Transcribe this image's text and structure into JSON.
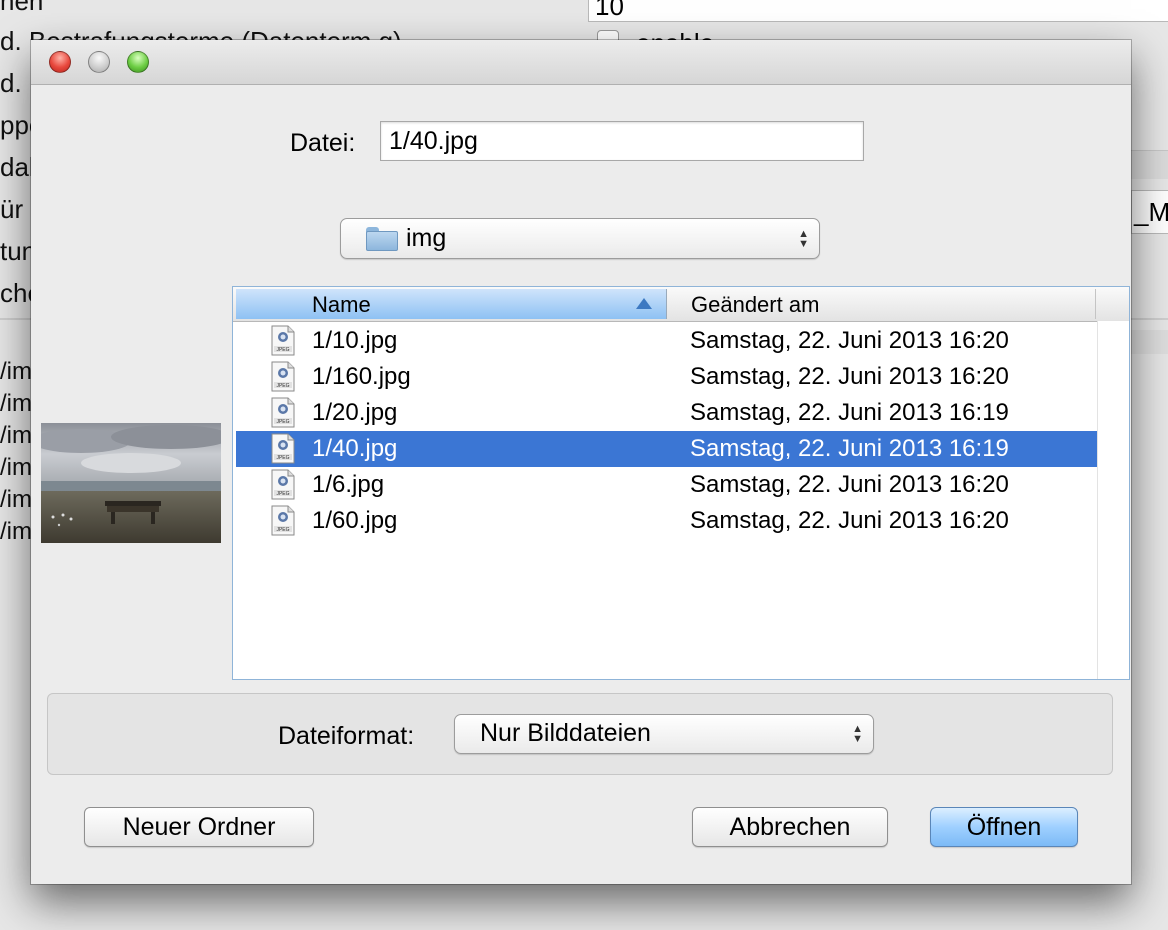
{
  "background_app": {
    "labels": [
      "hen",
      "d. Bestrafungsterme (Datenterm g)",
      "d. H",
      "ppe",
      "dal",
      "ür g",
      "tun",
      "che"
    ],
    "field_value": "10",
    "checkbox_label": "enable",
    "partial_text": "_Mu",
    "paths": [
      "/im",
      "/im",
      "/im",
      "/im",
      "/im",
      "/im"
    ]
  },
  "dialog": {
    "file_label": "Datei:",
    "file_value": "1/40.jpg",
    "folder_popup": {
      "icon": "folder-icon",
      "value": "img"
    },
    "table": {
      "columns": [
        "Name",
        "Geändert am"
      ],
      "sort_column": "Name",
      "sort_direction": "ascending",
      "rows": [
        {
          "name": "1/10.jpg",
          "date": "Samstag, 22. Juni 2013 16:20",
          "selected": false,
          "icon": "jpeg-file-icon"
        },
        {
          "name": "1/160.jpg",
          "date": "Samstag, 22. Juni 2013 16:20",
          "selected": false,
          "icon": "jpeg-file-icon"
        },
        {
          "name": "1/20.jpg",
          "date": "Samstag, 22. Juni 2013 16:19",
          "selected": false,
          "icon": "jpeg-file-icon"
        },
        {
          "name": "1/40.jpg",
          "date": "Samstag, 22. Juni 2013 16:19",
          "selected": true,
          "icon": "jpeg-file-icon"
        },
        {
          "name": "1/6.jpg",
          "date": "Samstag, 22. Juni 2013 16:20",
          "selected": false,
          "icon": "jpeg-file-icon"
        },
        {
          "name": "1/60.jpg",
          "date": "Samstag, 22. Juni 2013 16:20",
          "selected": false,
          "icon": "jpeg-file-icon"
        }
      ]
    },
    "format_label": "Dateiformat:",
    "format_value": "Nur Bilddateien",
    "buttons": {
      "new_folder": "Neuer Ordner",
      "cancel": "Abbrechen",
      "open": "Öffnen"
    },
    "colors": {
      "selection": "#3b76d4",
      "default_button": "#9fd0ff"
    }
  }
}
